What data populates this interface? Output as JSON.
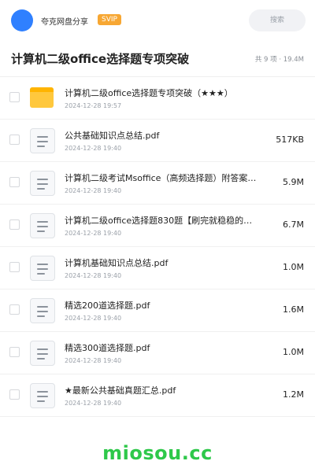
{
  "header": {
    "brand": "夸克网盘分享",
    "badge": "SVIP",
    "search_placeholder": "搜索"
  },
  "folder": {
    "title": "计算机二级office选择题专项突破",
    "summary": "共 9 项 · 19.4M"
  },
  "files": [
    {
      "name": "计算机二级office选择题专项突破（★★★）",
      "date": "2024-12-28 19:57",
      "size": "",
      "icon": "folder-icon"
    },
    {
      "name": "公共基础知识点总结.pdf",
      "date": "2024-12-28 19:40",
      "size": "517KB",
      "icon": "document-icon"
    },
    {
      "name": "计算机二级考试Msoffice（高频选择题）附答案…",
      "date": "2024-12-28 19:40",
      "size": "5.9M",
      "icon": "document-icon"
    },
    {
      "name": "计算机二级office选择题830题【刷完就稳稳的…",
      "date": "2024-12-28 19:40",
      "size": "6.7M",
      "icon": "document-icon"
    },
    {
      "name": "计算机基础知识点总结.pdf",
      "date": "2024-12-28 19:40",
      "size": "1.0M",
      "icon": "document-icon"
    },
    {
      "name": "精选200道选择题.pdf",
      "date": "2024-12-28 19:40",
      "size": "1.6M",
      "icon": "document-icon"
    },
    {
      "name": "精选300道选择题.pdf",
      "date": "2024-12-28 19:40",
      "size": "1.0M",
      "icon": "document-icon"
    },
    {
      "name": "★最新公共基础真题汇总.pdf",
      "date": "2024-12-28 19:40",
      "size": "1.2M",
      "icon": "document-icon"
    }
  ],
  "watermark": "miosou.cc",
  "colors": {
    "accent": "#2f80ff",
    "badge": "#f7a733",
    "folder": "#ffc83d",
    "watermark": "#2ec84a"
  }
}
